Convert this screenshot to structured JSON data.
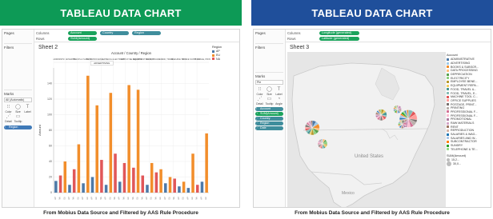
{
  "left": {
    "banner": "TABLEAU DATA CHART",
    "banner_color": "#0d9a56",
    "footnote": "From Mobius Data Source and Filtered by AAS Rule Procedure",
    "side": {
      "pages": "Pages",
      "filters": "Filters",
      "marks": "Marks",
      "mark_type": "All (Automatic)",
      "cards": [
        "Color",
        "Size",
        "Label",
        "Detail",
        "Tooltip"
      ],
      "pill": "Region"
    },
    "shelves": {
      "columns": "Columns",
      "rows": "Rows",
      "column_pills": [
        "Account",
        "Country",
        "Region"
      ],
      "row_pill": "SUM(Amount)"
    },
    "sheet": "Sheet 2",
    "header": "Account / Country / Region",
    "tooltip": "ADVERTISING",
    "legend": {
      "title": "Region",
      "items": [
        {
          "label": "AP",
          "color": "#4e79a7"
        },
        {
          "label": "EU",
          "color": "#f28e2b"
        },
        {
          "label": "NA",
          "color": "#e15759"
        }
      ]
    },
    "yaxis_label": "Amount",
    "col_headers": [
      "ADMINISTR...",
      "ADVERTIS...",
      "BOOKS & SUBSCR...",
      "DATA PROCESS...",
      "DEPRECIA...",
      "ELECTRICITY",
      "EMPLOYEE BENEFIT",
      "EQUIPMENT REPAIR",
      "FOOD, TRAVEL & ...",
      "FOOD, TRAVEL",
      "MACHINE TOOL",
      "OFFICE SUPPLIES",
      "POSTAGE, PRINT"
    ]
  },
  "chart_data": {
    "type": "bar",
    "title": "Sheet 2",
    "ylabel": "Amount",
    "ylim": [
      0,
      160
    ],
    "yticks": [
      0,
      20,
      40,
      60,
      80,
      100,
      120,
      140
    ],
    "series_colors": [
      "#4e79a7",
      "#f28e2b",
      "#e15759"
    ],
    "bars": [
      {
        "region": 0,
        "value": 15
      },
      {
        "region": 2,
        "value": 22
      },
      {
        "region": 1,
        "value": 40
      },
      {
        "region": 0,
        "value": 10
      },
      {
        "region": 2,
        "value": 30
      },
      {
        "region": 1,
        "value": 62
      },
      {
        "region": 0,
        "value": 12
      },
      {
        "region": 1,
        "value": 150
      },
      {
        "region": 0,
        "value": 20
      },
      {
        "region": 1,
        "value": 112
      },
      {
        "region": 2,
        "value": 42
      },
      {
        "region": 0,
        "value": 10
      },
      {
        "region": 1,
        "value": 128
      },
      {
        "region": 2,
        "value": 50
      },
      {
        "region": 0,
        "value": 14
      },
      {
        "region": 2,
        "value": 38
      },
      {
        "region": 1,
        "value": 138
      },
      {
        "region": 2,
        "value": 32
      },
      {
        "region": 1,
        "value": 132
      },
      {
        "region": 2,
        "value": 22
      },
      {
        "region": 0,
        "value": 10
      },
      {
        "region": 1,
        "value": 38
      },
      {
        "region": 2,
        "value": 26
      },
      {
        "region": 1,
        "value": 30
      },
      {
        "region": 0,
        "value": 12
      },
      {
        "region": 1,
        "value": 20
      },
      {
        "region": 2,
        "value": 18
      },
      {
        "region": 0,
        "value": 8
      },
      {
        "region": 1,
        "value": 14
      },
      {
        "region": 0,
        "value": 6
      },
      {
        "region": 1,
        "value": 50
      },
      {
        "region": 2,
        "value": 10
      },
      {
        "region": 0,
        "value": 14
      },
      {
        "region": 1,
        "value": 76
      }
    ]
  },
  "right": {
    "banner": "TABLEAU DATA CHART",
    "banner_color": "#1f4f9b",
    "footnote": "From Mobius Data Source and Filtered by AAS Rule Procedure",
    "side": {
      "pages": "Pages",
      "filters": "Filters",
      "marks": "Marks",
      "mark_type": "Pie",
      "cards": [
        "Color",
        "Size",
        "Label",
        "Detail",
        "Tooltip",
        "Angle"
      ],
      "pills": [
        "Account",
        "SUM(Amount)",
        "Country",
        "Region",
        "Date"
      ]
    },
    "shelves": {
      "columns": "Columns",
      "rows": "Rows",
      "column_pill": "Longitude (generated)",
      "row_pill": "Latitude (generated)"
    },
    "sheet": "Sheet 3",
    "map_labels": [
      "United States",
      "Mexico"
    ],
    "legend": {
      "title": "Account",
      "items": [
        {
          "label": "ADMINISTRATIVE",
          "color": "#4e79a7"
        },
        {
          "label": "ADVERTISING",
          "color": "#a0cbe8"
        },
        {
          "label": "BOOKS & SUBSCR...",
          "color": "#f28e2b"
        },
        {
          "label": "DATA PROCESSING",
          "color": "#ffbe7d"
        },
        {
          "label": "DEPRECIATION",
          "color": "#59a14f"
        },
        {
          "label": "ELECTRICITY",
          "color": "#8cd17d"
        },
        {
          "label": "EMPLOYEE BENE...",
          "color": "#b6992d"
        },
        {
          "label": "EQUIPMENT REPA...",
          "color": "#f1ce63"
        },
        {
          "label": "FOOD, TRAVEL &...",
          "color": "#499894"
        },
        {
          "label": "FOOD, TRAVEL, E...",
          "color": "#86bcb6"
        },
        {
          "label": "MACHINE TOOL C...",
          "color": "#e15759"
        },
        {
          "label": "OFFICE SUPPLIES",
          "color": "#ff9d9a"
        },
        {
          "label": "POSTAGE, PRINT...",
          "color": "#79706e"
        },
        {
          "label": "PRINTING",
          "color": "#bab0ac"
        },
        {
          "label": "PROFESSIONAL F...",
          "color": "#d37295"
        },
        {
          "label": "PROFESSIONAL F...",
          "color": "#fabfd2"
        },
        {
          "label": "PROMOTIONAL",
          "color": "#b07aa1"
        },
        {
          "label": "RAW MATERIALS",
          "color": "#d4a6c8"
        },
        {
          "label": "RENT",
          "color": "#9d7660"
        },
        {
          "label": "REPRODUCTION",
          "color": "#d7b5a6"
        },
        {
          "label": "SALARIES & WAG...",
          "color": "#1f77b4"
        },
        {
          "label": "SALARIES AND W...",
          "color": "#aec7e8"
        },
        {
          "label": "SUBCONTRACTOR",
          "color": "#ff7f0e"
        },
        {
          "label": "SUNDRY",
          "color": "#2ca02c"
        },
        {
          "label": "TELEPHONE & TE...",
          "color": "#98df8a"
        }
      ],
      "size_title": "SUM(Amount)",
      "size_values": [
        "15,2...",
        "30,0..."
      ]
    },
    "pies": [
      {
        "lon": -122.4,
        "lat": 37.8,
        "radius": 9
      },
      {
        "lon": -117.2,
        "lat": 32.7,
        "radius": 6
      },
      {
        "lon": -87.6,
        "lat": 41.9,
        "radius": 7
      },
      {
        "lon": -73.9,
        "lat": 40.7,
        "radius": 11
      },
      {
        "lon": -77.0,
        "lat": 38.9,
        "radius": 5
      },
      {
        "lon": -79.4,
        "lat": 43.7,
        "radius": 5
      }
    ],
    "pie_slices": [
      0.09,
      0.07,
      0.11,
      0.05,
      0.08,
      0.06,
      0.07,
      0.04,
      0.06,
      0.05,
      0.05,
      0.04,
      0.05,
      0.03,
      0.04,
      0.03,
      0.03,
      0.02,
      0.03
    ]
  }
}
